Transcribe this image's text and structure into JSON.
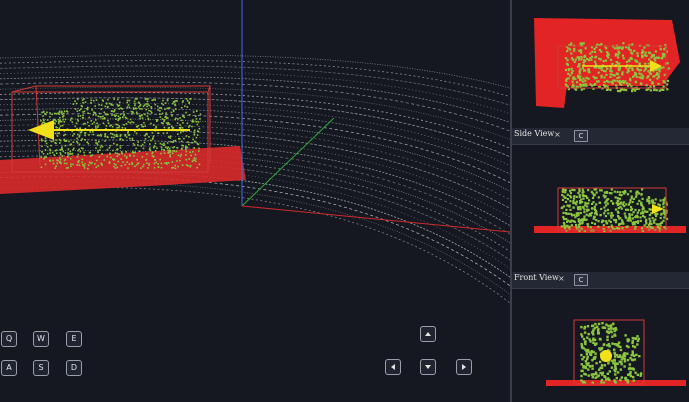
{
  "colors": {
    "background": "#151820",
    "ground_points": "#e03030",
    "object_points": "#8cc63f",
    "heading_arrow": "#f2e01a",
    "box_outline": "#d23a3a",
    "cloud_points": "#cfd3d8",
    "axis_x": "#d02a2a",
    "axis_y": "#2fa83a",
    "axis_z": "#3a6fe0"
  },
  "views": {
    "side": {
      "title": "Side View",
      "close": "×",
      "button": "C"
    },
    "front": {
      "title": "Front View",
      "close": "×",
      "button": "C"
    }
  },
  "controls": {
    "keys": [
      "Q",
      "W",
      "E",
      "A",
      "S",
      "D"
    ],
    "arrows": [
      "up-arrow",
      "left-arrow",
      "down-arrow",
      "right-arrow"
    ]
  }
}
